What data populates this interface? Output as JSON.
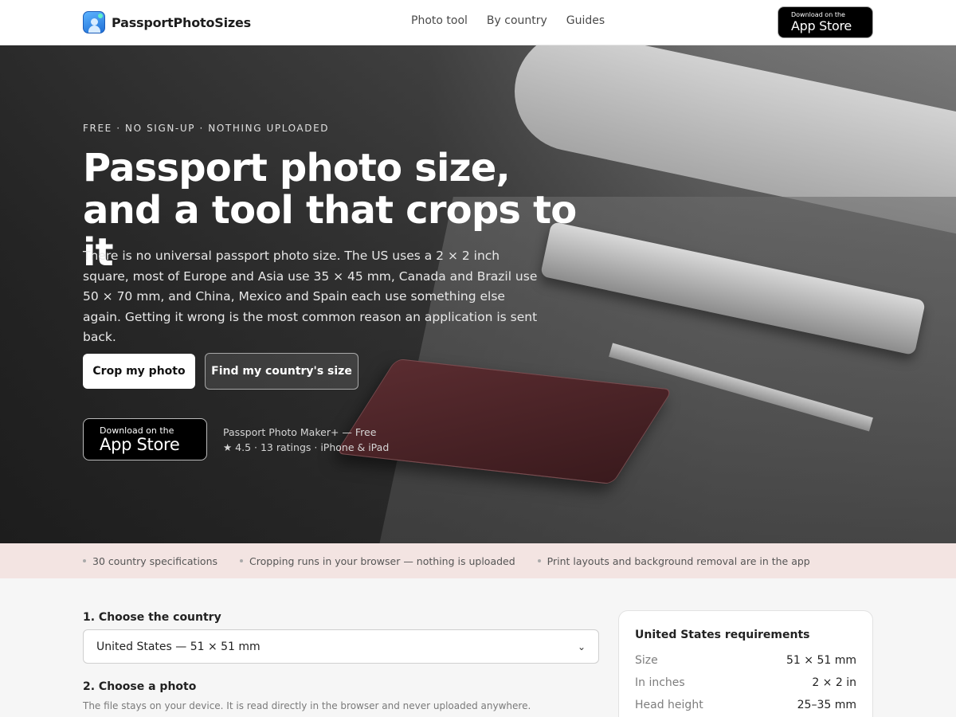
{
  "header": {
    "brand": "PassportPhotoSizes",
    "nav": [
      "Photo tool",
      "By country",
      "Guides"
    ],
    "app_badge_small": "Download on the",
    "app_badge_big": "App Store"
  },
  "hero": {
    "eyebrow": "FREE · NO SIGN-UP · NOTHING UPLOADED",
    "title": "Passport photo size, and a tool that crops to it",
    "body": "There is no universal passport photo size. The US uses a 2 × 2 inch square, most of Europe and Asia use 35 × 45 mm, Canada and Brazil use 50 × 70 mm, and China, Mexico and Spain each use something else again. Getting it wrong is the most common reason an application is sent back.",
    "primary_button": "Crop my photo",
    "secondary_button": "Find my country's size",
    "badge_small": "Download on the",
    "badge_big": "App Store",
    "app_name": "Passport Photo Maker+ — Free",
    "app_rating": "★ 4.5 · 13 ratings · iPhone & iPad"
  },
  "features": [
    "30 country specifications",
    "Cropping runs in your browser — nothing is uploaded",
    "Print layouts and background removal are in the app"
  ],
  "tool": {
    "step1": "1. Choose the country",
    "country_selected": "United States — 51 × 51 mm",
    "step2": "2. Choose a photo",
    "step2_help": "The file stays on your device. It is read directly in the browser and never uploaded anywhere."
  },
  "requirements": {
    "title": "United States requirements",
    "rows": [
      {
        "label": "Size",
        "value": "51 × 51 mm"
      },
      {
        "label": "In inches",
        "value": "2 × 2 in"
      },
      {
        "label": "Head height",
        "value": "25–35 mm"
      }
    ]
  },
  "icons": {
    "brand": "passport-photo-logo-icon",
    "apple": "apple-icon",
    "select": "chevron-down-icon"
  }
}
